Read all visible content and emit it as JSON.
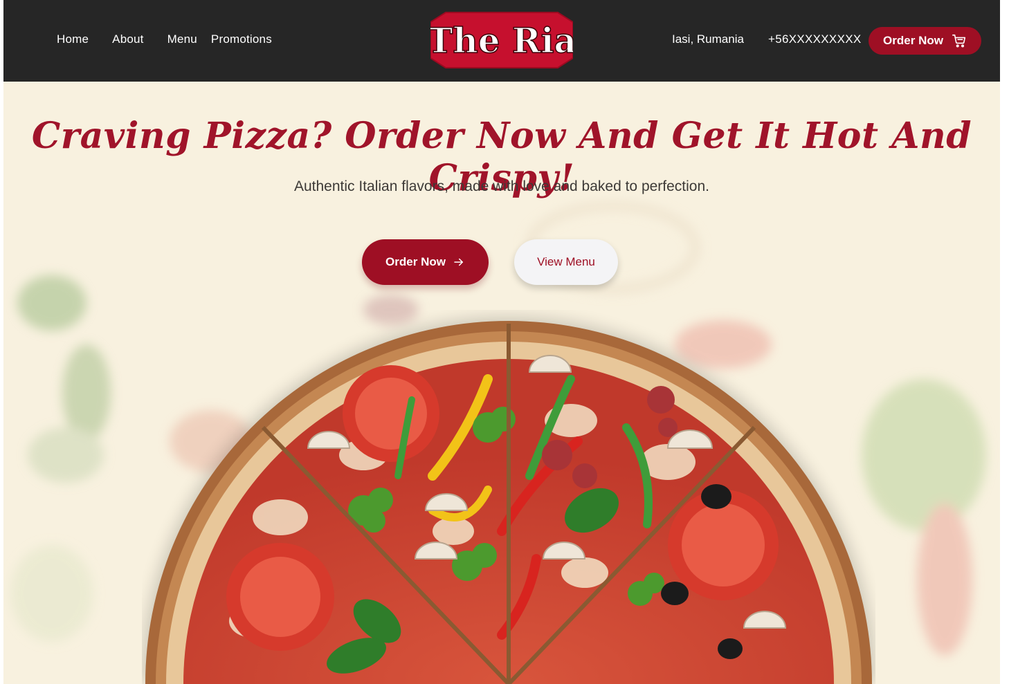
{
  "nav": {
    "links": [
      "Home",
      "About",
      "Menu",
      "Promotions"
    ],
    "location": "Iasi, Rumania",
    "phone": "+56XXXXXXXXX",
    "order_label": "Order Now",
    "order_icon": "cart-icon"
  },
  "logo": {
    "text": "The Ria"
  },
  "hero": {
    "title": "Craving Pizza? Order Now And Get It Hot And Crispy!",
    "subtitle": "Authentic Italian flavors, made with love and baked to perfection.",
    "order_label": "Order Now",
    "order_icon": "arrow-right-icon",
    "menu_label": "View Menu"
  },
  "colors": {
    "accent": "#9e0f24",
    "navbar": "#262626",
    "hero_bg": "#f8f1df"
  }
}
